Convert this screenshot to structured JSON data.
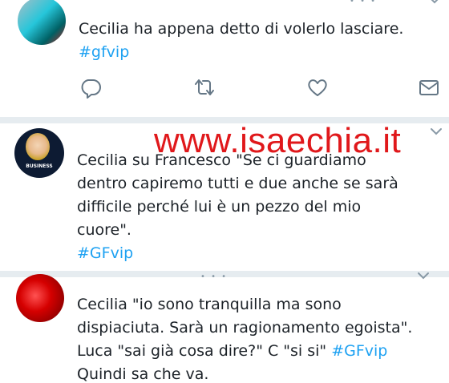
{
  "tweets": [
    {
      "text_lines": [
        "Cecilia ha appena detto di volerlo lasciare."
      ],
      "hashtag": "#gfvip",
      "actions": [
        "reply",
        "retweet",
        "like",
        "direct-message"
      ]
    },
    {
      "text_lines": [
        "Cecilia su Francesco \"Se ci guardiamo",
        "dentro capiremo tutti e due anche se sarà",
        "difficile perché lui è un pezzo del mio",
        "cuore\"."
      ],
      "hashtag": "#GFvip",
      "avatar_caption": "BUSINESS"
    },
    {
      "line1": "Cecilia \"io sono tranquilla ma sono",
      "line2": "dispiaciuta. Sarà un ragionamento egoista\".",
      "line3_prefix": "Luca \"sai già cosa dire?\" C \"si si\" ",
      "line3_hashtag": "#GFvip",
      "line4": "Quindi sa che va."
    }
  ],
  "watermark": "www.isaechia.it",
  "icons": {
    "reply": "reply-icon",
    "retweet": "retweet-icon",
    "like": "heart-icon",
    "dm": "envelope-icon",
    "caret": "chevron-down-icon"
  },
  "colors": {
    "hashtag": "#1da1f2",
    "icon": "#657786",
    "separator": "#e6ecf0",
    "watermark": "#e0181b"
  }
}
